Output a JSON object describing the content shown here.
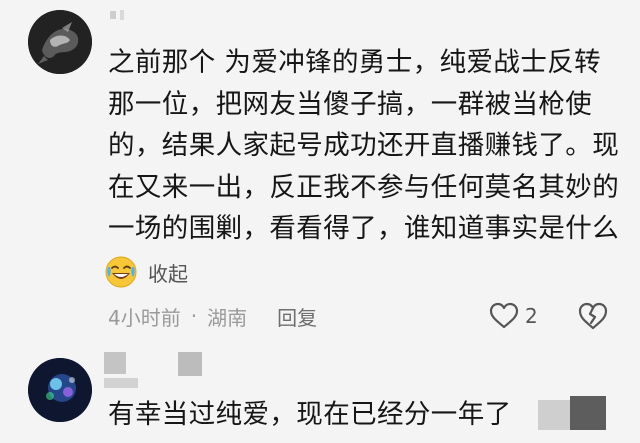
{
  "comments": [
    {
      "text_lines": [
        "之前那个 为爱冲锋的勇士，纯爱战士反转",
        "那一位，把网友当傻子搞，一群被当枪使",
        "的，结果人家起号成功还开直播赚钱了。现",
        "在又来一出，反正我不参与任何莫名其妙的",
        "一场的围剿，看看得了，谁知道事实是什么"
      ],
      "emoji_icon": "laughing-crying-emoji",
      "collapse_label": "收起",
      "time": "4小时前",
      "separator": "·",
      "region": "湖南",
      "reply_label": "回复",
      "like_count": "2",
      "like_icon": "heart-outline-icon",
      "dislike_icon": "broken-heart-icon"
    },
    {
      "text": "有幸当过纯爱，现在已经分一年了"
    }
  ],
  "colors": {
    "background": "#f4f4f5",
    "text": "#161616",
    "meta": "#9a9a9a",
    "emoji_face": "#f7c738"
  }
}
